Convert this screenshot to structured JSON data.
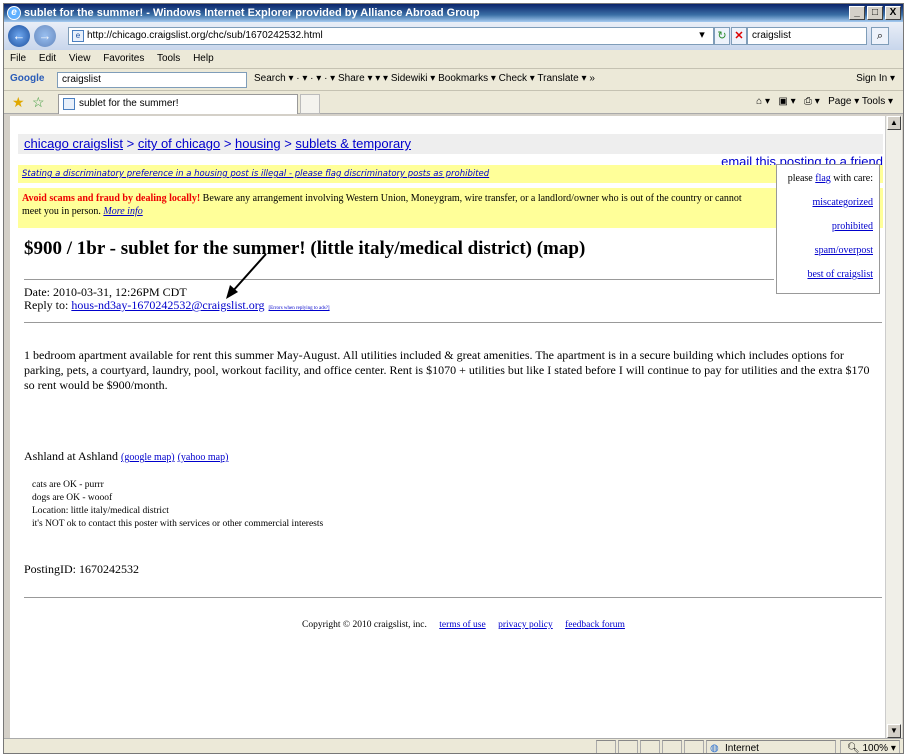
{
  "window": {
    "title": "sublet for the summer! - Windows Internet Explorer provided by Alliance Abroad Group",
    "minimize": "_",
    "maximize": "□",
    "close": "X"
  },
  "address_bar": {
    "url": "http://chicago.craigslist.org/chc/sub/1670242532.html",
    "search_text": "craigslist"
  },
  "menu": [
    "File",
    "Edit",
    "View",
    "Favorites",
    "Tools",
    "Help"
  ],
  "google_bar": {
    "logo": "Google",
    "query": "craigslist",
    "items": "Search ▾  ·  ▾  ·  ▾  ·  ▾    Share ▾    ▾    ▾    Sidewiki ▾    Bookmarks ▾    Check ▾   Translate ▾  »",
    "sign_in": "Sign In ▾"
  },
  "tab": {
    "label": "sublet for the summer!",
    "tools": "Page ▾    Tools ▾"
  },
  "page": {
    "breadcrumb": [
      "chicago craigslist",
      "city of chicago",
      "housing",
      "sublets & temporary"
    ],
    "email_link": "email this posting to a friend",
    "discrimination_notice": "Stating a discriminatory preference in a housing post is illegal - please flag discriminatory posts as prohibited",
    "scam_bold": "Avoid scams and fraud by dealing locally!",
    "scam_text": " Beware any arrangement involving Western Union, Moneygram, wire transfer, or a landlord/owner who is out of the country or cannot meet you in person. ",
    "scam_more": "More info",
    "flag": {
      "prefix": "please ",
      "flag_link": "flag",
      "suffix": " with care:",
      "items": [
        "miscategorized",
        "prohibited",
        "spam/overpost",
        "best of craigslist"
      ]
    },
    "title": "$900 / 1br - sublet for the summer! (little italy/medical district) (map)",
    "date": "Date: 2010-03-31, 12:26PM CDT",
    "reply_label": "Reply to: ",
    "reply_email": "hous-nd3ay-1670242532@craigslist.org",
    "reply_note": "[Errors when replying to ads?]",
    "body": "1 bedroom apartment available for rent this summer May-August. All utilities included & great amenities. The apartment is in a secure building which includes options for parking, pets, a courtyard, laundry, pool, workout facility, and office center. Rent is $1070 + utilities but like I stated before I will continue to pay for utilities and the extra $170 so rent would be $900/month.",
    "location_label": "Ashland at Ashland ",
    "google_map": "(google map)",
    "yahoo_map": "(yahoo map)",
    "notes": [
      "cats are OK - purrr",
      "dogs are OK - wooof",
      "Location: little italy/medical district",
      "it's NOT ok to contact this poster with services or other commercial interests"
    ],
    "posting_id": "PostingID: 1670242532",
    "copyright": "Copyright © 2010 craigslist, inc.",
    "footer_links": [
      "terms of use",
      "privacy policy",
      "feedback forum"
    ]
  },
  "status": {
    "zone": "Internet",
    "zoom": "100%"
  }
}
